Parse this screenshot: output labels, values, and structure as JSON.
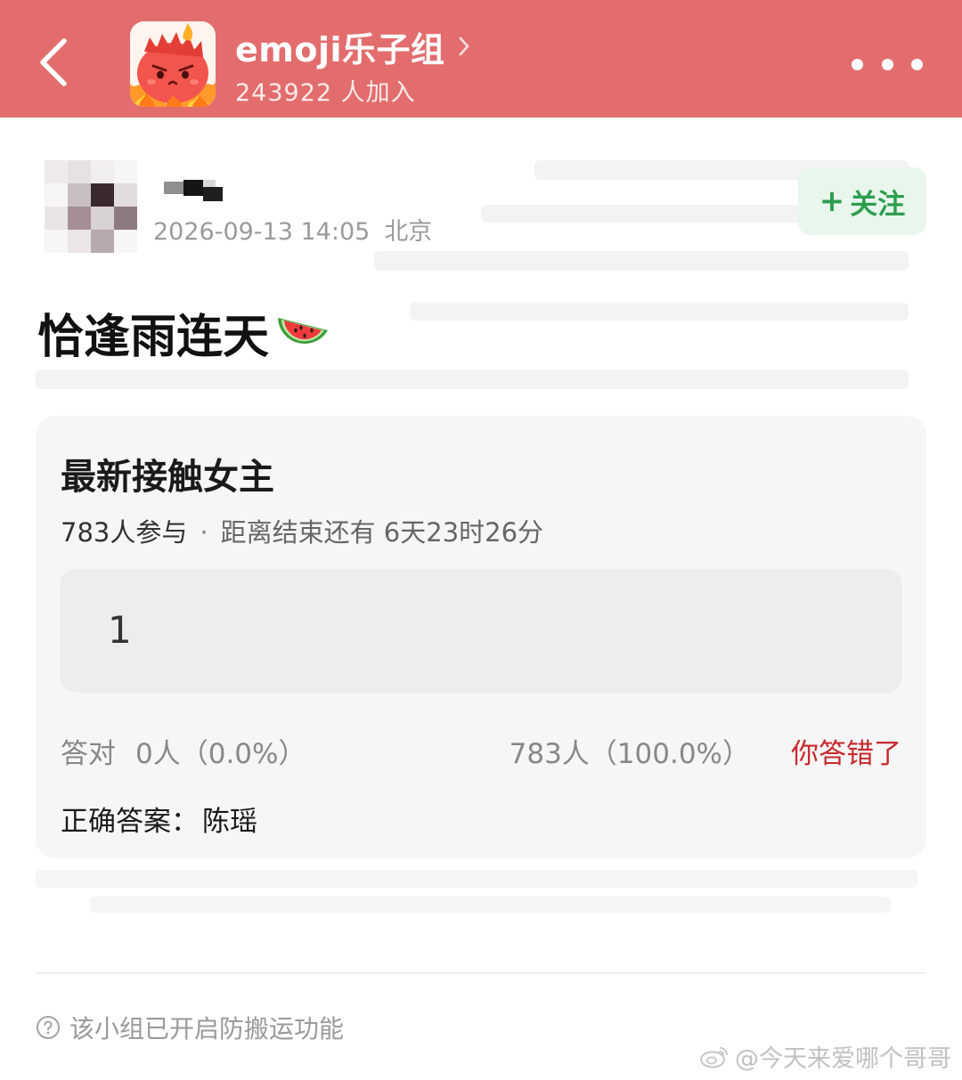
{
  "colors": {
    "header_bg": "#e36d6d",
    "follow_text": "#2e9e4f",
    "follow_bg": "#e9f6ec",
    "wrong_answer": "#c8282d",
    "card_bg": "#f6f6f6"
  },
  "header": {
    "back_icon": "chevron-left-icon",
    "group_name": "emoji乐子组",
    "member_count": "243922 人加入",
    "more_icon": "more-dots-icon"
  },
  "post": {
    "timestamp": "2026-09-13 14:05",
    "location": "北京",
    "follow_label": "关注",
    "follow_plus": "+",
    "title": "恰逢雨连天",
    "title_emoji": "watermelon-icon"
  },
  "quiz": {
    "title": "最新接触女主",
    "participants": "783人参与",
    "separator": "·",
    "time_remaining": "距离结束还有 6天23时26分",
    "user_answer": "1",
    "correct_label": "答对",
    "correct_stat": "0人（0.0%）",
    "wrong_stat": "783人（100.0%）",
    "result_text": "你答错了",
    "correct_answer_label": "正确答案：",
    "correct_answer_value": "陈瑶"
  },
  "footer": {
    "note": "该小组已开启防搬运功能",
    "watermark": "@今天来爱哪个哥哥"
  }
}
